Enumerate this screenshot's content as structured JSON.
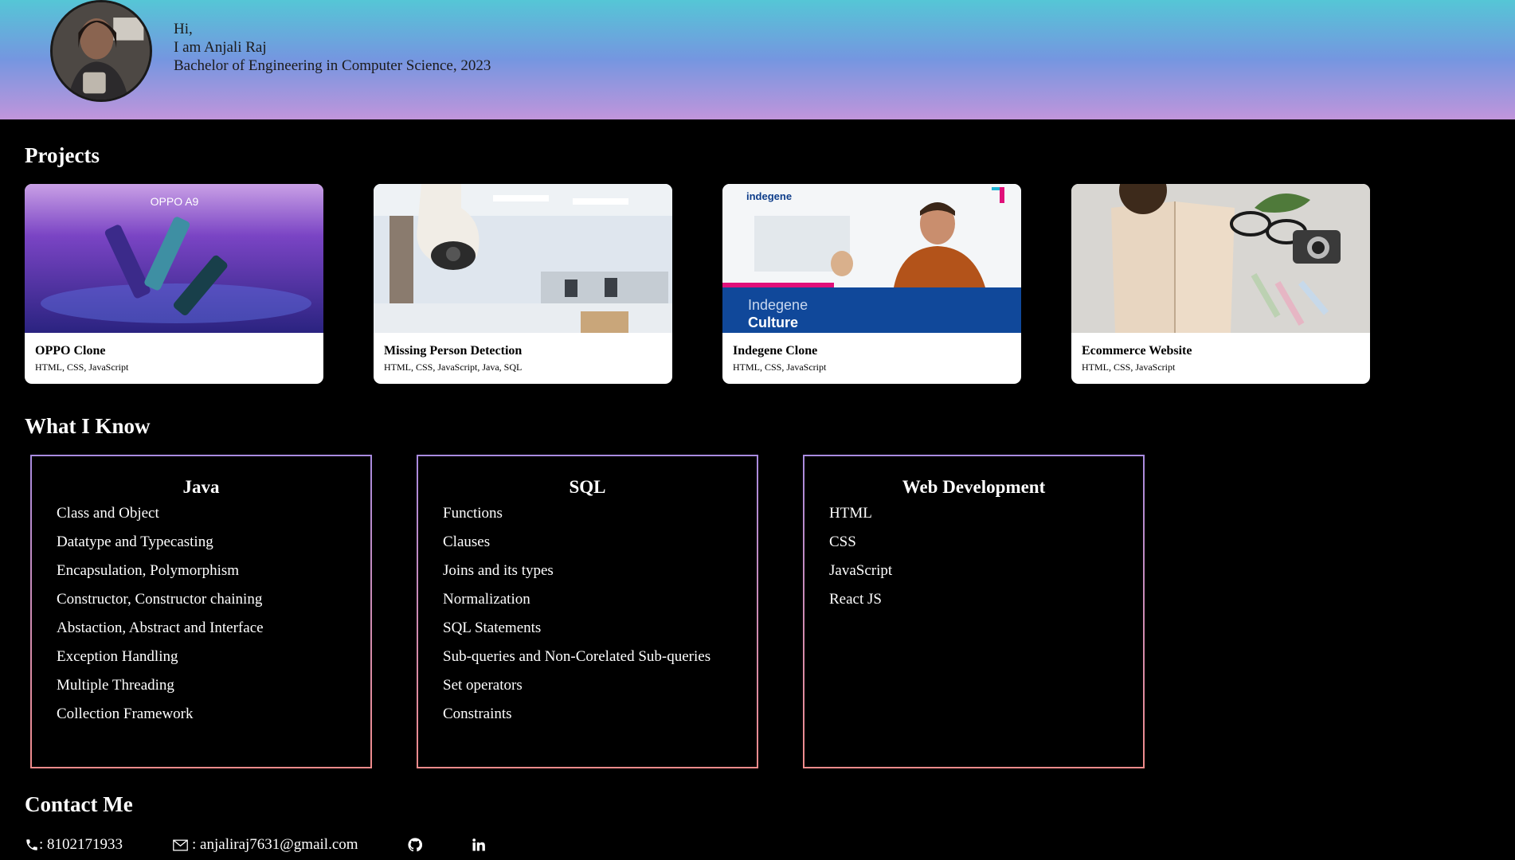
{
  "header": {
    "greeting": "Hi,",
    "name_line": "I am Anjali Raj",
    "degree_line": "Bachelor of Engineering in Computer Science, 2023"
  },
  "projects": {
    "heading": "Projects",
    "items": [
      {
        "title": "OPPO Clone",
        "tech": "HTML, CSS, JavaScript",
        "image_text": "OPPO A9"
      },
      {
        "title": "Missing Person Detection",
        "tech": "HTML, CSS, JavaScript, Java, SQL"
      },
      {
        "title": "Indegene Clone",
        "tech": "HTML, CSS, JavaScript",
        "image_brand": "indegene",
        "image_caption_1": "Indegene",
        "image_caption_2": "Culture"
      },
      {
        "title": "Ecommerce Website",
        "tech": "HTML, CSS, JavaScript"
      }
    ]
  },
  "skills": {
    "heading": "What I Know",
    "groups": [
      {
        "title": "Java",
        "items": [
          "Class and Object",
          "Datatype and Typecasting",
          "Encapsulation, Polymorphism",
          "Constructor, Constructor chaining",
          "Abstaction, Abstract and Interface",
          "Exception Handling",
          "Multiple Threading",
          "Collection Framework"
        ]
      },
      {
        "title": "SQL",
        "items": [
          "Functions",
          "Clauses",
          "Joins and its types",
          "Normalization",
          "SQL Statements",
          "Sub-queries and Non-Corelated Sub-queries",
          "Set operators",
          "Constraints"
        ]
      },
      {
        "title": "Web Development",
        "items": [
          "HTML",
          "CSS",
          "JavaScript",
          "React JS"
        ]
      }
    ]
  },
  "contact": {
    "heading": "Contact Me",
    "phone": ": 8102171933",
    "email": ": anjaliraj7631@gmail.com",
    "icons": [
      "phone-icon",
      "mail-icon",
      "github-icon",
      "linkedin-icon"
    ]
  }
}
